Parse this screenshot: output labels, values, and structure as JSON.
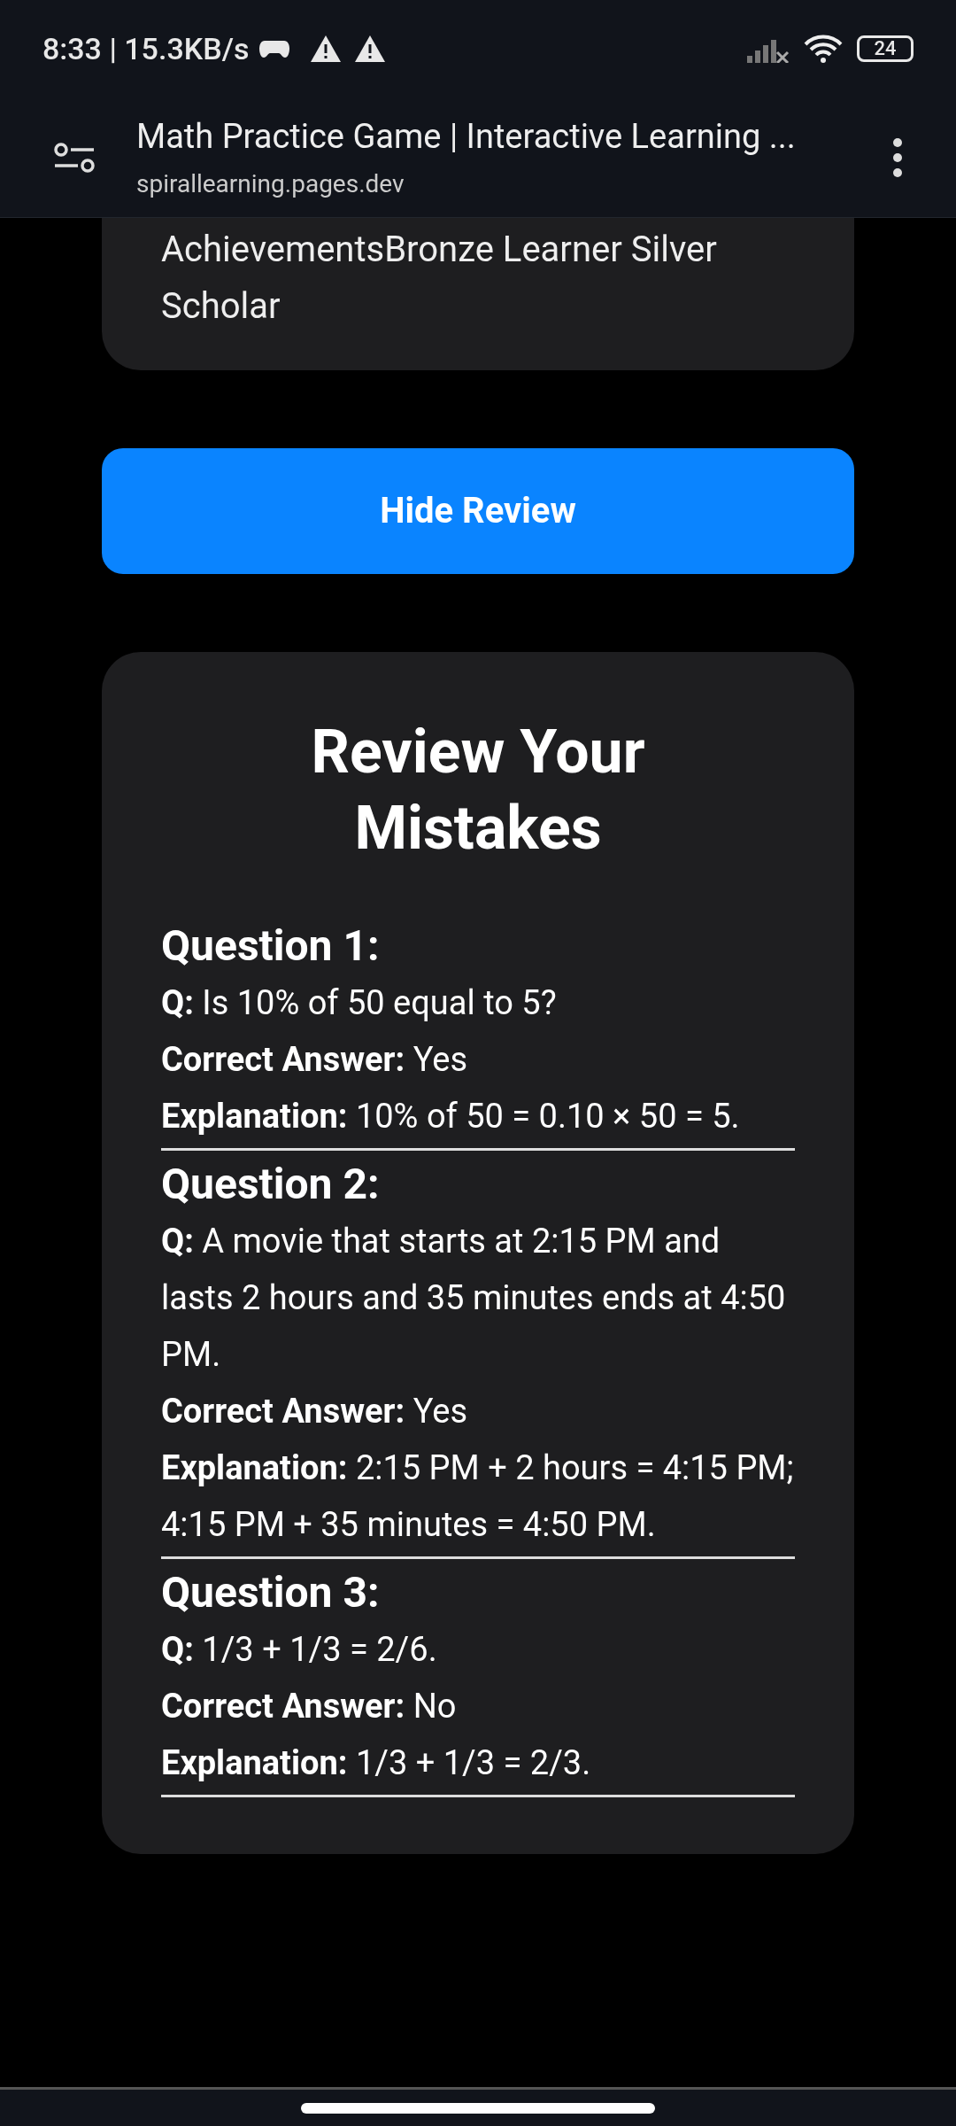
{
  "status_bar": {
    "time": "8:33 | 15.3KB/s",
    "battery": "24"
  },
  "browser": {
    "title": "Math Practice Game | Interactive Learning ...",
    "url": "spirallearning.pages.dev"
  },
  "achievements": {
    "text": "AchievementsBronze Learner Silver Scholar"
  },
  "hide_review_button": "Hide Review",
  "review": {
    "title": "Review Your Mistakes",
    "questions": [
      {
        "heading": "Question 1:",
        "question": "**Q:** Is 10% of 50 equal to 5?",
        "answer": "**Correct Answer:** Yes",
        "explanation": "**Explanation:** 10% of 50 = 0.10 × 50 = 5."
      },
      {
        "heading": "Question 2:",
        "question": "**Q:** A movie that starts at 2:15 PM and lasts 2 hours and 35 minutes ends at 4:50 PM.",
        "answer": "**Correct Answer:** Yes",
        "explanation": "**Explanation:** 2:15 PM + 2 hours = 4:15 PM; 4:15 PM + 35 minutes = 4:50 PM."
      },
      {
        "heading": "Question 3:",
        "question": "**Q:** 1/3 + 1/3 = 2/6.",
        "answer": "**Correct Answer:** No",
        "explanation": "**Explanation:** 1/3 + 1/3 = 2/3."
      }
    ]
  }
}
